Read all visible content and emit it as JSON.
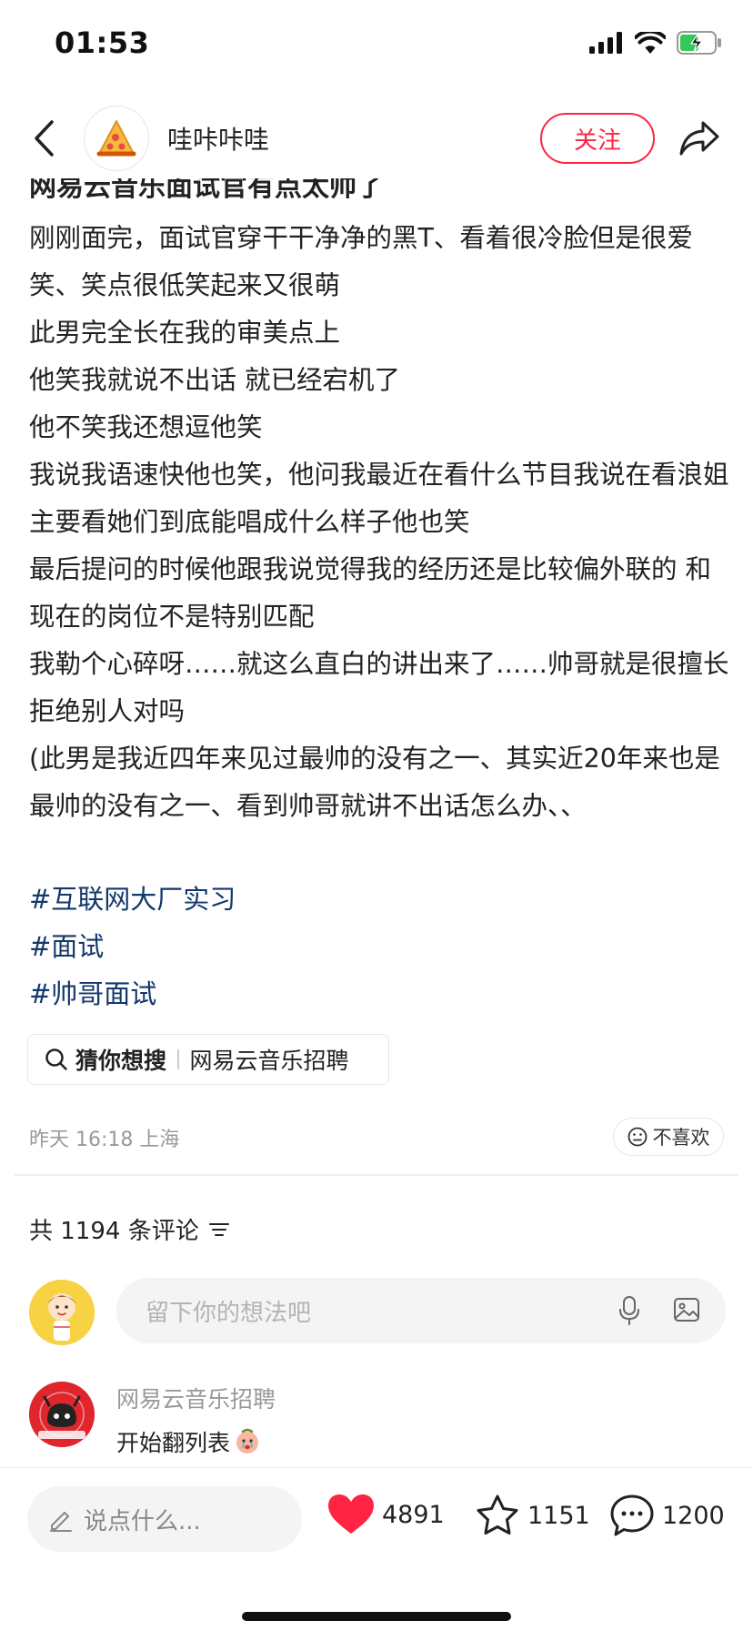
{
  "status": {
    "time": "01:53"
  },
  "header": {
    "author_name": "哇咔咔哇",
    "follow_label": "关注"
  },
  "post": {
    "title": "网易云音乐面试官有点太帅了",
    "paragraphs": [
      "刚刚面完，面试官穿干干净净的黑T、看着很冷脸但是很爱笑、笑点很低笑起来又很萌",
      "此男完全长在我的审美点上",
      "他笑我就说不出话 就已经宕机了",
      "他不笑我还想逗他笑",
      "我说我语速快他也笑，他问我最近在看什么节目我说在看浪姐主要看她们到底能唱成什么样子他也笑",
      "最后提问的时候他跟我说觉得我的经历还是比较偏外联的 和现在的岗位不是特别匹配",
      "我勒个心碎呀……就这么直白的讲出来了……帅哥就是很擅长拒绝别人对吗",
      "(此男是我近四年来见过最帅的没有之一、其实近20年来也是最帅的没有之一、看到帅哥就讲不出话怎么办、、"
    ],
    "tags": [
      "#互联网大厂实习",
      "#面试",
      "#帅哥面试"
    ],
    "search_chip": {
      "label": "猜你想搜",
      "query": "网易云音乐招聘"
    },
    "meta": "昨天 16:18 上海",
    "dislike_label": "不喜欢"
  },
  "comments": {
    "count_label": "共 1194 条评论",
    "input_placeholder": "留下你的想法吧",
    "items": [
      {
        "author": "网易云音乐招聘",
        "text": "开始翻列表"
      }
    ]
  },
  "bottom_bar": {
    "input_placeholder": "说点什么...",
    "likes": "4891",
    "collects": "1151",
    "comments": "1200"
  },
  "colors": {
    "accent": "#ff2442",
    "tag": "#13386c",
    "muted": "#999999"
  }
}
